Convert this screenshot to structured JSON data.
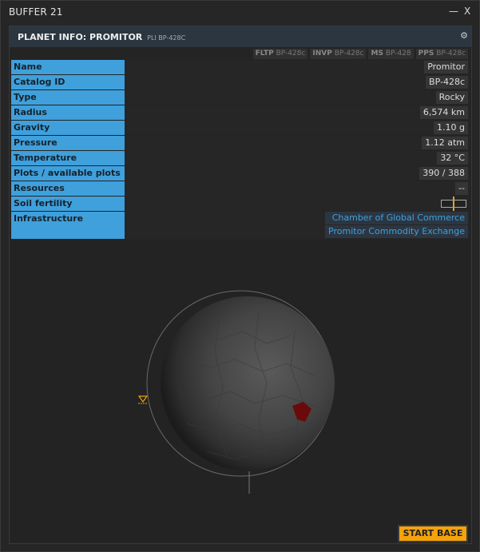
{
  "window": {
    "title": "BUFFER 21",
    "controls": [
      "—",
      "X"
    ]
  },
  "panel": {
    "title": "PLANET INFO: PROMITOR",
    "subtitle": "PLI BP-428C",
    "settings_icon": "gear-icon"
  },
  "codes": [
    {
      "tag": "FLTP",
      "value": "BP-428c"
    },
    {
      "tag": "INVP",
      "value": "BP-428c"
    },
    {
      "tag": "MS",
      "value": "BP-428"
    },
    {
      "tag": "PPS",
      "value": "BP-428c"
    }
  ],
  "info": {
    "name": {
      "label": "Name",
      "value": "Promitor"
    },
    "catalog": {
      "label": "Catalog ID",
      "value": "BP-428c"
    },
    "type": {
      "label": "Type",
      "value": "Rocky"
    },
    "radius": {
      "label": "Radius",
      "value": "6,574 km"
    },
    "gravity": {
      "label": "Gravity",
      "value": "1.10 g"
    },
    "pressure": {
      "label": "Pressure",
      "value": "1.12 atm"
    },
    "temperature": {
      "label": "Temperature",
      "value": "32 °C"
    },
    "plots": {
      "label": "Plots / available plots",
      "value": "390 / 388"
    },
    "resources": {
      "label": "Resources",
      "value": "--"
    },
    "soil": {
      "label": "Soil fertility",
      "level": 0.5
    },
    "infrastructure": {
      "label": "Infrastructure",
      "items": [
        "Chamber of Global Commerce",
        "Promitor Commodity Exchange"
      ]
    }
  },
  "colors": {
    "label_bg": "#3fa0dc",
    "link": "#3fa0dc",
    "accent": "#f4a30c",
    "resource_patch": "#6b0a0a"
  },
  "viewport": {
    "marker_icon": "orbit-marker-icon"
  },
  "actions": {
    "start_base": "START BASE"
  }
}
